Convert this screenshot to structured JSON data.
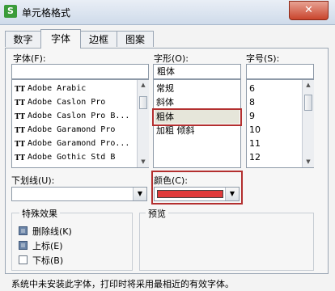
{
  "dialog": {
    "title": "单元格格式",
    "close_symbol": "✕",
    "app_icon_letter": "S"
  },
  "tabs": [
    {
      "label": "数字",
      "active": false
    },
    {
      "label": "字体",
      "active": true
    },
    {
      "label": "边框",
      "active": false
    },
    {
      "label": "图案",
      "active": false
    }
  ],
  "font": {
    "label": "字体(F):",
    "value": "",
    "items": [
      "Adobe Arabic",
      "Adobe Caslon Pro",
      "Adobe Caslon Pro B...",
      "Adobe Garamond Pro",
      "Adobe Garamond Pro...",
      "Adobe Gothic Std B"
    ],
    "item_icon": "truetype-font-icon"
  },
  "style": {
    "label": "字形(O):",
    "value": "粗体",
    "items": [
      "常规",
      "斜体",
      "粗体",
      "加粗 倾斜"
    ],
    "selected": "粗体"
  },
  "size": {
    "label": "字号(S):",
    "value": "",
    "items": [
      "6",
      "8",
      "9",
      "10",
      "11",
      "12"
    ]
  },
  "underline": {
    "label": "下划线(U):",
    "value": ""
  },
  "color": {
    "label": "颜色(C):",
    "value_color": "#e03a3a"
  },
  "effects": {
    "title": "特殊效果",
    "items": [
      {
        "label": "删除线(K)",
        "checked": true
      },
      {
        "label": "上标(E)",
        "checked": true
      },
      {
        "label": "下标(B)",
        "checked": false
      }
    ]
  },
  "preview": {
    "title": "预览"
  },
  "footer": {
    "note": "系统中未安装此字体，打印时将采用最相近的有效字体。"
  },
  "colors": {
    "highlight_frame": "#b32f2f",
    "selected_item_bg": "#e6e6da"
  }
}
